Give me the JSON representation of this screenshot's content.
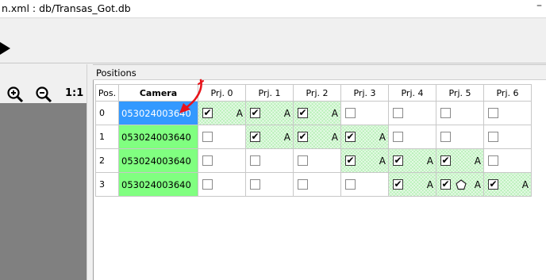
{
  "window": {
    "title": "n.xml : db/Transas_Got.db",
    "minimize_glyph": "–"
  },
  "toolbar": {
    "play_icon": "play-icon"
  },
  "left_panel": {
    "zoom_in_icon": "zoom-in-icon",
    "zoom_out_icon": "zoom-out-icon",
    "one_to_one_label": "1:1"
  },
  "positions_panel": {
    "title": "Positions",
    "columns": [
      "Pos.",
      "Camera",
      "Prj. 0",
      "Prj. 1",
      "Prj. 2",
      "Prj. 3",
      "Prj. 4",
      "Prj. 5",
      "Prj. 6"
    ],
    "rows": [
      {
        "pos": "0",
        "camera": "053024003640",
        "cells": [
          {
            "checked": true,
            "flag": "A"
          },
          {
            "checked": true,
            "flag": "A"
          },
          {
            "checked": true,
            "flag": "A"
          },
          {
            "checked": false,
            "flag": ""
          },
          {
            "checked": false,
            "flag": ""
          },
          {
            "checked": false,
            "flag": ""
          },
          {
            "checked": false,
            "flag": ""
          }
        ]
      },
      {
        "pos": "1",
        "camera": "053024003640",
        "cells": [
          {
            "checked": false,
            "flag": ""
          },
          {
            "checked": true,
            "flag": "A"
          },
          {
            "checked": true,
            "flag": "A"
          },
          {
            "checked": true,
            "flag": "A"
          },
          {
            "checked": false,
            "flag": ""
          },
          {
            "checked": false,
            "flag": ""
          },
          {
            "checked": false,
            "flag": ""
          }
        ]
      },
      {
        "pos": "2",
        "camera": "053024003640",
        "cells": [
          {
            "checked": false,
            "flag": ""
          },
          {
            "checked": false,
            "flag": ""
          },
          {
            "checked": false,
            "flag": ""
          },
          {
            "checked": true,
            "flag": "A"
          },
          {
            "checked": true,
            "flag": "A"
          },
          {
            "checked": true,
            "flag": "A"
          },
          {
            "checked": false,
            "flag": ""
          }
        ]
      },
      {
        "pos": "3",
        "camera": "053024003640",
        "cells": [
          {
            "checked": false,
            "flag": ""
          },
          {
            "checked": false,
            "flag": ""
          },
          {
            "checked": false,
            "flag": ""
          },
          {
            "checked": false,
            "flag": ""
          },
          {
            "checked": true,
            "flag": "A"
          },
          {
            "checked": true,
            "flag": "A",
            "marker": "pentagon"
          },
          {
            "checked": true,
            "flag": "A"
          }
        ]
      }
    ],
    "selected_row": 0,
    "check_glyph": "✔",
    "annotation_icon": "red-arrow-icon",
    "colors": {
      "camera_bg": "#80ff80",
      "selected_bg": "#3399ff",
      "active_cell": "#b8f0b8",
      "annotation": "#e8141b"
    }
  }
}
